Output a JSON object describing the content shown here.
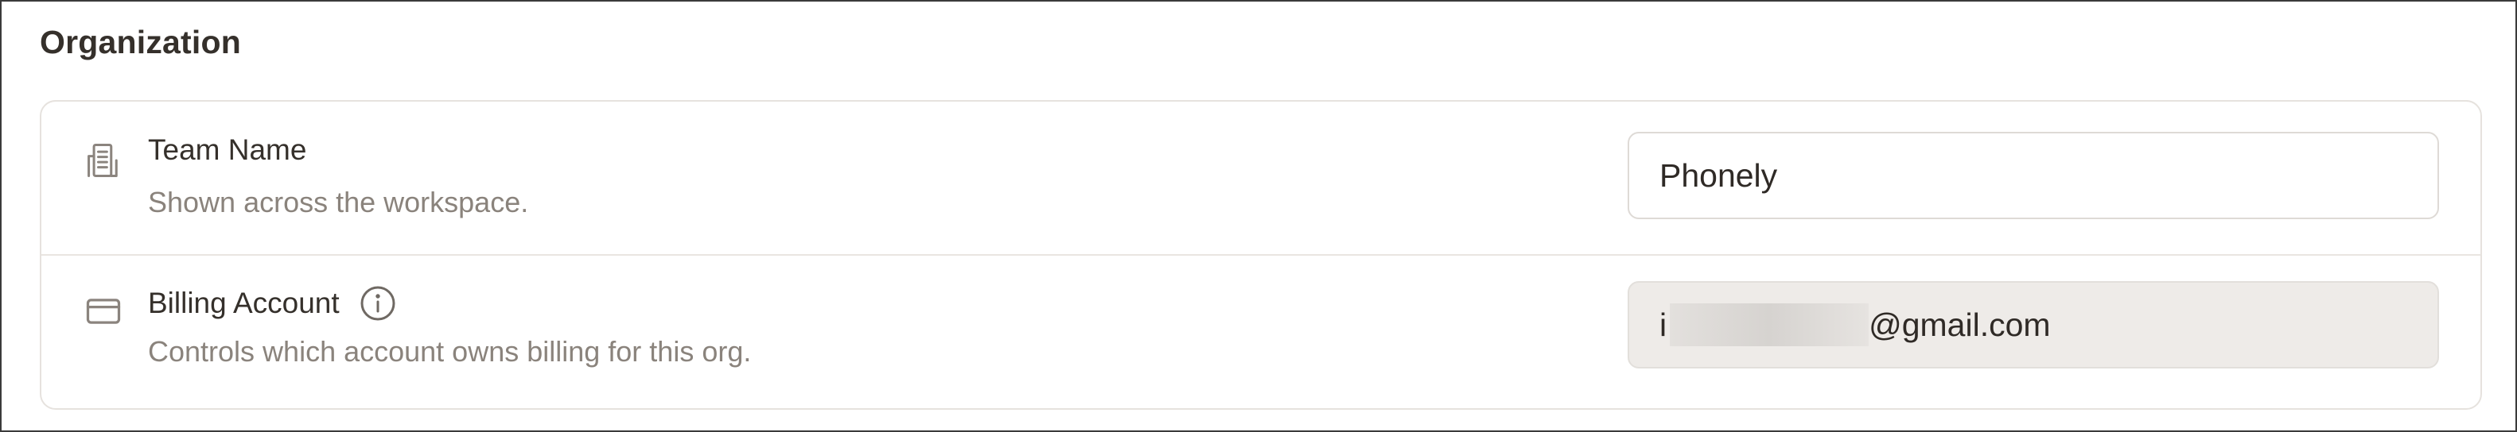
{
  "section": {
    "title": "Organization"
  },
  "rows": [
    {
      "icon": "building-icon",
      "title": "Team Name",
      "description": "Shown across the workspace.",
      "value": "Phonely"
    },
    {
      "icon": "credit-card-icon",
      "title": "Billing Account",
      "info_icon": "info-icon",
      "description": "Controls which account owns billing for this org.",
      "value_prefix": "i",
      "value_suffix": "@gmail.com"
    }
  ]
}
